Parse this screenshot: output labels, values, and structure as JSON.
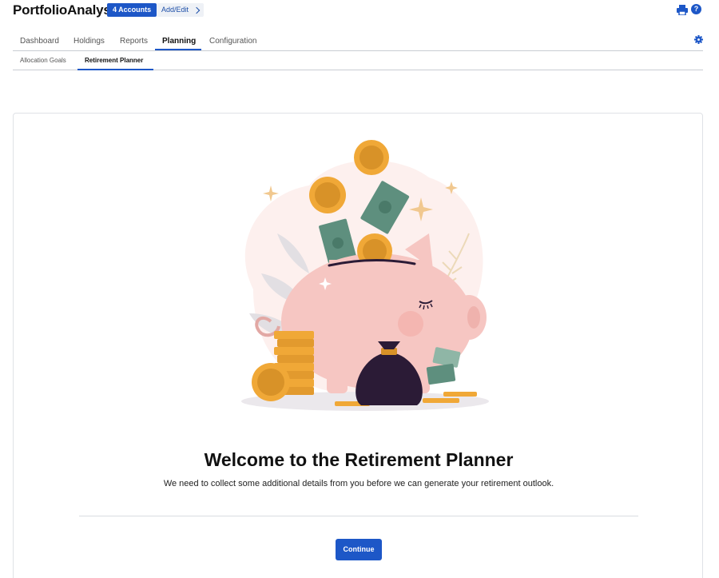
{
  "header": {
    "app_title": "PortfolioAnalyst",
    "accounts_label": "4 Accounts",
    "add_edit_label": "Add/Edit",
    "print_icon": "print-icon",
    "help_icon": "help-icon",
    "help_glyph": "?"
  },
  "main_tabs": [
    {
      "label": "Dashboard",
      "active": false
    },
    {
      "label": "Holdings",
      "active": false
    },
    {
      "label": "Reports",
      "active": false
    },
    {
      "label": "Planning",
      "active": true
    },
    {
      "label": "Configuration",
      "active": false
    }
  ],
  "sub_tabs": [
    {
      "label": "Allocation Goals",
      "active": false
    },
    {
      "label": "Retirement Planner",
      "active": true
    }
  ],
  "welcome": {
    "title": "Welcome to the Retirement Planner",
    "subtitle": "We need to collect some additional details from you before we can generate your retirement outlook.",
    "continue_label": "Continue"
  },
  "colors": {
    "accent": "#1d57c7",
    "coin": "#f0a837",
    "pig": "#f6c6c2",
    "bill": "#5e8f7e",
    "bag": "#2b1b36"
  }
}
